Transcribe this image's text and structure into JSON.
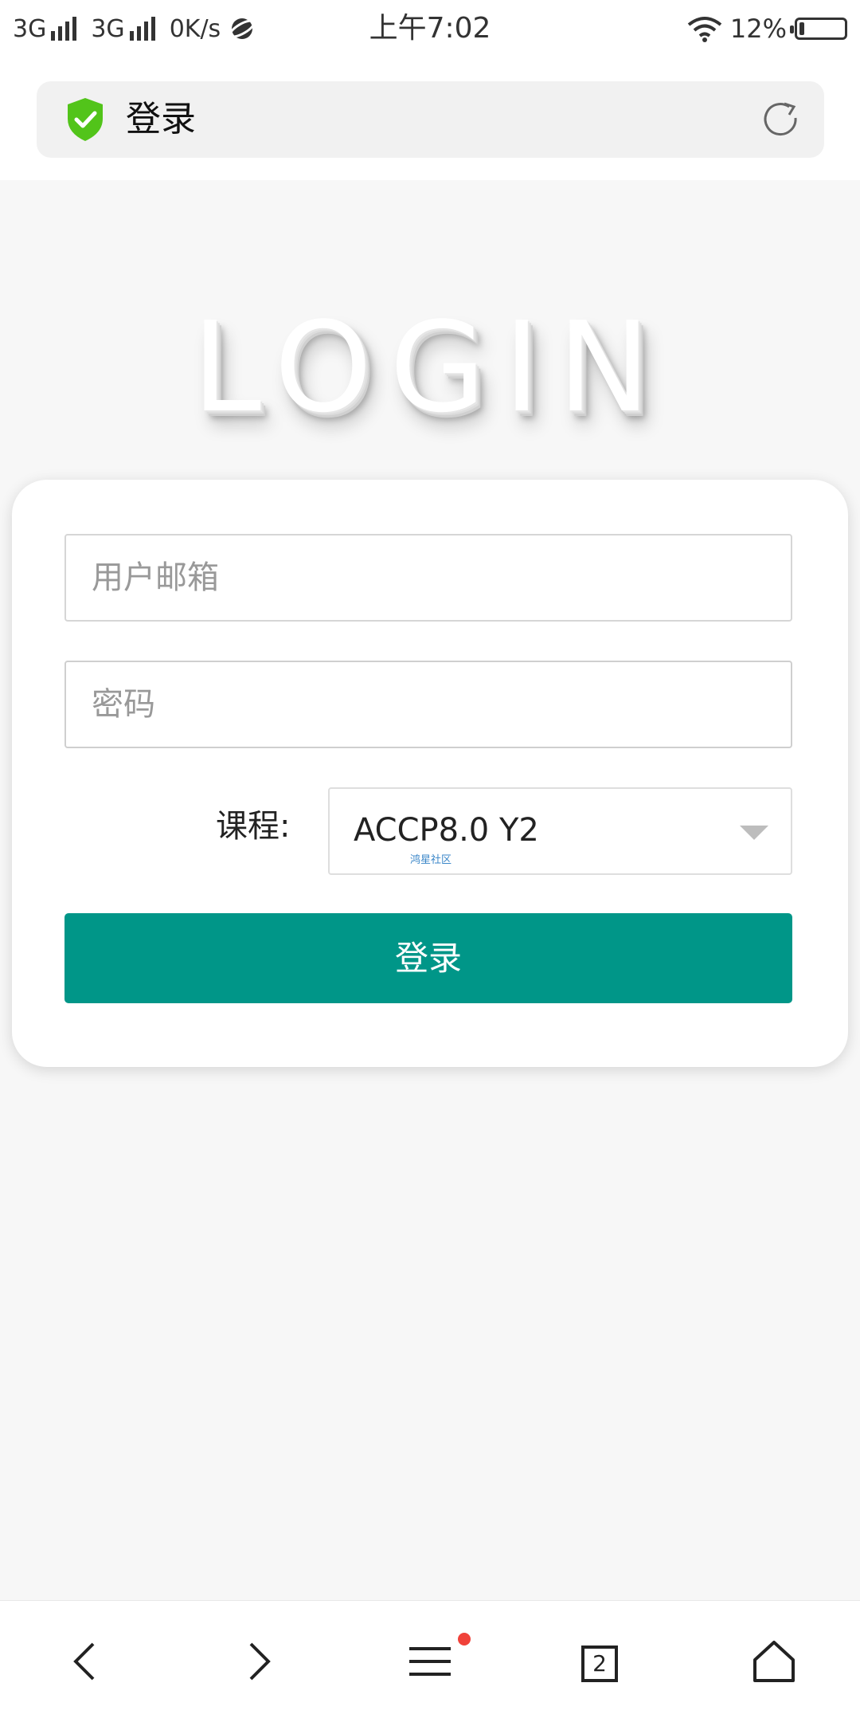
{
  "status_bar": {
    "network1": "3G",
    "network2": "3G",
    "speed": "0K/s",
    "time": "上午7:02",
    "battery": "12%",
    "battery_level": 0.12
  },
  "address_bar": {
    "title": "登录",
    "secure_color": "#52c41a"
  },
  "page": {
    "heading": "LOGIN"
  },
  "form": {
    "email_placeholder": "用户邮箱",
    "password_placeholder": "密码",
    "course_label": "课程:",
    "course_value": "ACCP8.0 Y2",
    "course_watermark": "鸿星社区",
    "submit_label": "登录",
    "accent_color": "#009688"
  },
  "bottom_nav": {
    "tab_count": "2",
    "items": [
      "back-icon",
      "forward-icon",
      "menu-icon",
      "tabs-icon",
      "home-icon"
    ]
  }
}
